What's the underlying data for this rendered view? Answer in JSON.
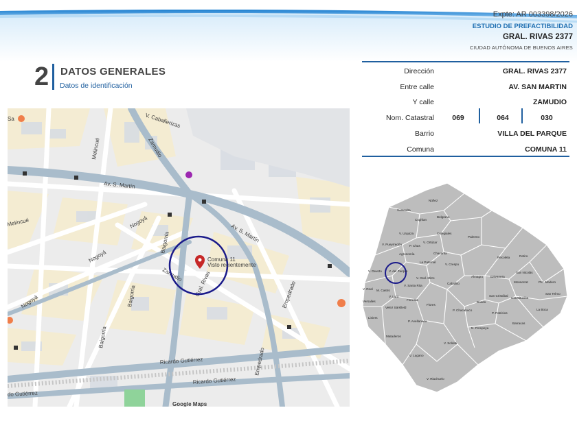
{
  "header": {
    "expte": "Expte: AR 003398/2026",
    "estudio": "ESTUDIO DE PREFACTIBILIDAD",
    "address": "GRAL. RIVAS 2377",
    "city": "CIUDAD AUTÓNOMA DE BUENOS AIRES"
  },
  "section": {
    "number": "2",
    "title": "DATOS GENERALES",
    "subtitle": "Datos de identificación"
  },
  "info": {
    "direccion_label": "Dirección",
    "direccion_value": "GRAL. RIVAS 2377",
    "entre_label": "Entre calle",
    "entre_value": "AV. SAN MARTIN",
    "ycalle_label": "Y calle",
    "ycalle_value": "ZAMUDIO",
    "catastral_label": "Nom. Catastral",
    "catastral_values": [
      "069",
      "064",
      "030"
    ],
    "barrio_label": "Barrio",
    "barrio_value": "VILLA DEL PARQUE",
    "comuna_label": "Comuna",
    "comuna_value": "COMUNA 11"
  },
  "map": {
    "streets": {
      "caballerizas": "V. Caballerizas",
      "zamudio_top": "Zamudio",
      "melincue_top": "Melincué",
      "av_san_martin_1": "Av. S. Martín",
      "av_san_martin_2": "Av. S. Martín",
      "melincue_left": "Melincué",
      "nogoya_1": "Nogoyá",
      "nogoya_2": "Nogoyá",
      "nogoya_3": "Nogoyá",
      "baigorria_1": "Baigorria",
      "baigorria_2": "Baigorria",
      "baigorria_3": "Baigorria",
      "zamudio_mid": "Zamudio",
      "gral_rivas": "Gral. Rivas",
      "empedrado_1": "Empedrado",
      "empedrado_2": "Empedrado",
      "ricardo_1": "Ricardo Gutiérrez",
      "ricardo_2": "Ricardo Gutiérrez",
      "ricardo_3": "do Gutiérrez",
      "google": "Google Maps",
      "sa": "Sa"
    },
    "pin_title": "Comuna 11",
    "pin_subtitle": "Visto recientemente",
    "colors": {
      "accent": "#1a1a8a",
      "pin": "#c62828",
      "road": "#a9bccb"
    }
  },
  "barrios": {
    "labels": {
      "saavedra": "Saavedra",
      "nunez": "Núñez",
      "coghlan": "Coghlan",
      "belgrano": "Belgrano",
      "v_urquiza": "V. Urquiza",
      "v_pueyrredon": "V. Pueyrredón",
      "p_chas": "P. Chas",
      "v_ortuzar": "V. Ortúzar",
      "colegiales": "Colegiales",
      "palermo": "Palermo",
      "agronomia": "Agronomía",
      "chacarita": "Chacarita",
      "v_devoto": "V. Devoto",
      "v_del_parque": "V. del Parque",
      "la_paternal": "La Paternal",
      "v_crespo": "V. Crespo",
      "recoleta": "Recoleta",
      "retiro": "Retiro",
      "v_gral_mitre": "V. Gral. Mitre",
      "v_santa_rita": "V. Santa Rita",
      "v_real": "V. Real",
      "m_castro": "M. Castro",
      "almagro": "Almagro",
      "balvanera": "Balvanera",
      "san_nicolas": "San Nicolás",
      "monserrat": "Monserrat",
      "pto_madero": "Pto. Madero",
      "caballito": "Caballito",
      "versalles": "Versalles",
      "floresta": "Floresta",
      "v_luro": "V. Luro",
      "velez_sarsfield": "Velez Sársfield",
      "flores": "Flores",
      "boedo": "Boedo",
      "san_cristobal": "San Cristóbal",
      "constitucion": "Constitución",
      "san_telmo": "San Telmo",
      "liniers": "Liniers",
      "p_avellaneda": "P. Avellaneda",
      "p_chacabuco": "P. Chacabuco",
      "p_patricios": "P. Patricios",
      "la_boca": "La Boca",
      "barracas": "Barracas",
      "n_pompeya": "N. Pompeya",
      "mataderos": "Mataderos",
      "v_soldati": "V. Soldati",
      "v_lugano": "V. Lugano",
      "v_riachuelo": "V. Riachuelo"
    }
  }
}
